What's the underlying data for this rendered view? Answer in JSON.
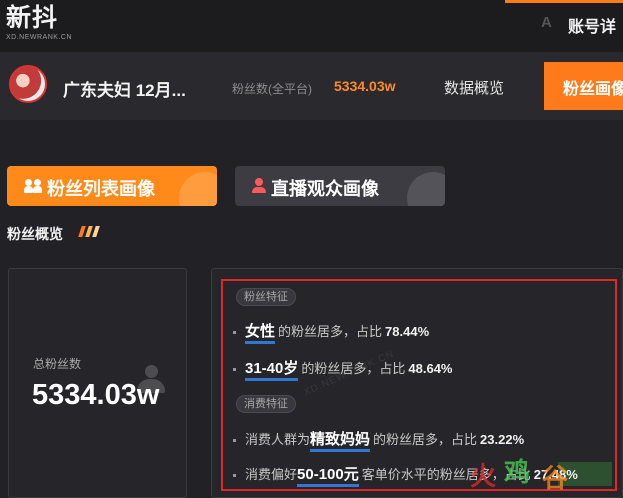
{
  "header": {
    "logo": "新抖",
    "logo_sub": "XD.NEWRANK.CN",
    "font_toggle": "A",
    "detail_link": "账号详"
  },
  "profile": {
    "name": "广东夫妇 12月...",
    "fans_label": "粉丝数(全平台)",
    "fans_value": "5334.03w",
    "tabs": [
      "数据概览",
      "粉丝画像"
    ]
  },
  "subtabs": [
    {
      "label": "粉丝列表画像",
      "icon": "people-icon",
      "active": true
    },
    {
      "label": "直播观众画像",
      "icon": "user-icon",
      "active": false
    }
  ],
  "section_title": "粉丝概览",
  "total": {
    "label": "总粉丝数",
    "value": "5334.03w"
  },
  "features": {
    "group1_tag": "粉丝特征",
    "group2_tag": "消费特征",
    "items": [
      {
        "prefix": "",
        "highlight": "女性",
        "suffix": "的粉丝居多，占比",
        "pct": "78.44%"
      },
      {
        "prefix": "",
        "highlight": "31-40岁",
        "suffix": "的粉丝居多，占比",
        "pct": "48.64%"
      },
      {
        "prefix": "消费人群为",
        "highlight": "精致妈妈",
        "suffix": "的粉丝居多，占比",
        "pct": "23.22%"
      },
      {
        "prefix": "消费偏好",
        "highlight": "50-100元",
        "suffix": "客单价水平的粉丝居多，占比",
        "pct": "27.48%"
      }
    ]
  },
  "watermarks": {
    "diagonal": "XD.NEWRANK.CN",
    "corner": "火鸡谷"
  },
  "colors": {
    "accent": "#ff7a1a",
    "highlight_underline": "#2f78d6",
    "annotation_box": "#e0282a"
  }
}
